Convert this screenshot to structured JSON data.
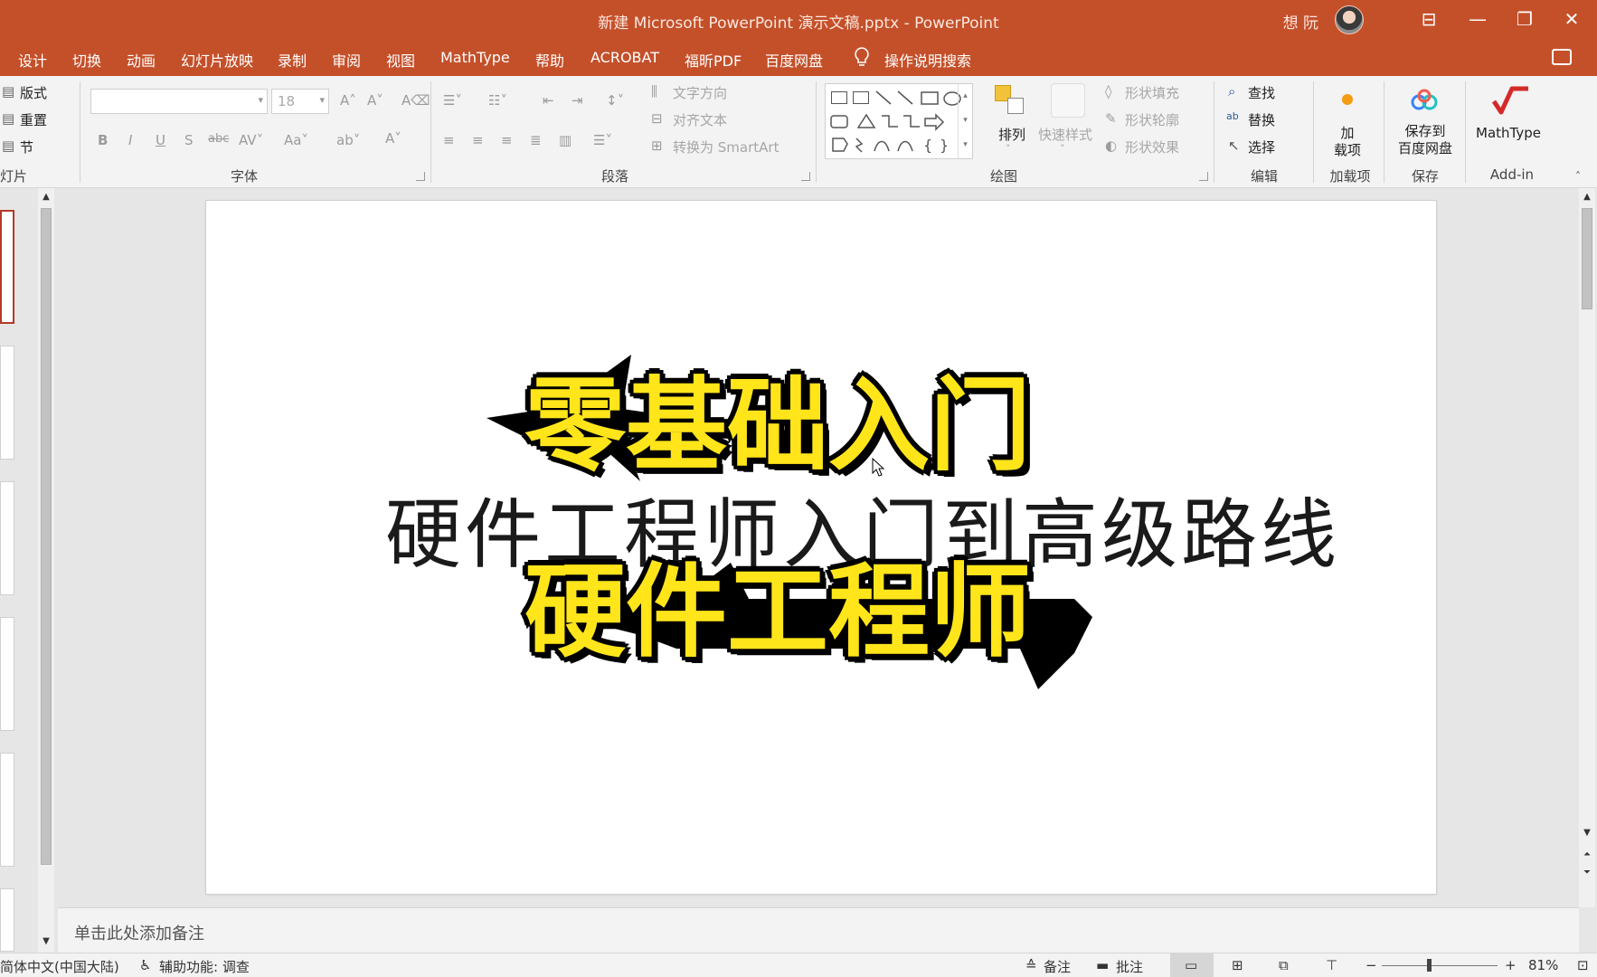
{
  "window": {
    "title": "新建 Microsoft PowerPoint 演示文稿.pptx  -  PowerPoint",
    "user": "想 阮",
    "controls": [
      "⊟",
      "—",
      "❐",
      "✕"
    ]
  },
  "menu": {
    "tabs": [
      "设计",
      "切换",
      "动画",
      "幻灯片放映",
      "录制",
      "审阅",
      "视图",
      "MathType",
      "帮助",
      "ACROBAT",
      "福昕PDF",
      "百度网盘"
    ],
    "search": "操作说明搜索"
  },
  "ribbon": {
    "slides_group": {
      "layout": "版式",
      "reset": "重置",
      "section": "节",
      "label": "灯片"
    },
    "font_group": {
      "font_name": "",
      "font_size": "18",
      "label": "字体"
    },
    "paragraph_group": {
      "text_direction": "文字方向",
      "align_text": "对齐文本",
      "smartart": "转换为 SmartArt",
      "label": "段落"
    },
    "drawing_group": {
      "arrange": "排列",
      "quick_styles": "快速样式",
      "shape_fill": "形状填充",
      "shape_outline": "形状轮廓",
      "shape_effects": "形状效果",
      "label": "绘图"
    },
    "editing_group": {
      "find": "查找",
      "replace": "替换",
      "select": "选择",
      "label": "编辑"
    },
    "addins_group": {
      "button": "加\n载项",
      "label": "加载项"
    },
    "save_group": {
      "button": "保存到\n百度网盘",
      "label": "保存"
    },
    "mathtype_group": {
      "button": "MathType",
      "label": "Add-in"
    }
  },
  "slide": {
    "headline_top": "零基础入门",
    "subtitle": "硬件工程师入门到高级路线",
    "headline_bottom": "硬件工程师"
  },
  "notes": {
    "placeholder": "单击此处添加备注"
  },
  "status": {
    "language": "简体中文(中国大陆)",
    "accessibility": "辅助功能: 调查",
    "notes_btn": "备注",
    "comments_btn": "批注",
    "zoom": "81%"
  },
  "colors": {
    "accent": "#c4502a",
    "headline_fill": "#ffe51a"
  }
}
